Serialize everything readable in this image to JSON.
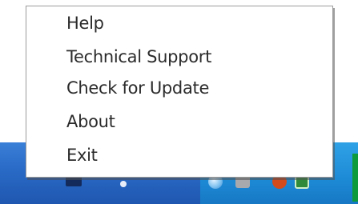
{
  "context_menu": {
    "items": [
      {
        "label": "Help"
      },
      {
        "label": "Technical Support"
      },
      {
        "label": "Check for Update"
      },
      {
        "label": "About"
      },
      {
        "label": "Exit"
      }
    ]
  },
  "taskbar": {
    "tray_icons": [
      "globe-icon",
      "tray-app-icon",
      "tray-orange-icon",
      "tray-green-icon"
    ],
    "colors": {
      "taskbar_blue": "#2a6cc8",
      "tray_blue": "#1d8ad6"
    }
  }
}
